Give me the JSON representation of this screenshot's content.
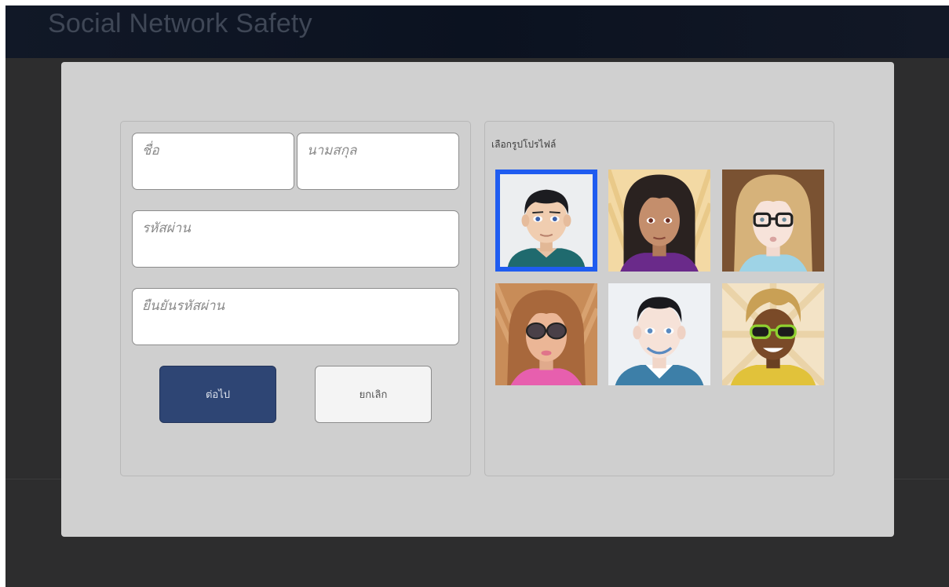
{
  "header": {
    "app_title": "Social Network Safety"
  },
  "form": {
    "first_name": {
      "placeholder": "ชื่อ",
      "value": ""
    },
    "last_name": {
      "placeholder": "นามสกุล",
      "value": ""
    },
    "password": {
      "placeholder": "รหัสผ่าน",
      "value": ""
    },
    "confirm_password": {
      "placeholder": "ยืนยันรหัสผ่าน",
      "value": ""
    },
    "next_label": "ต่อไป",
    "cancel_label": "ยกเลิก"
  },
  "profile_picker": {
    "label": "เลือกรูปโปรไฟล์",
    "selected_index": 0,
    "selection_color": "#1f5cf0",
    "avatars": [
      {
        "name": "boy-short-black-hair-avatar"
      },
      {
        "name": "girl-long-curly-hair-avatar"
      },
      {
        "name": "girl-blonde-glasses-avatar"
      },
      {
        "name": "girl-sunglasses-avatar"
      },
      {
        "name": "boy-smiling-avatar"
      },
      {
        "name": "boy-green-sunglasses-avatar"
      }
    ]
  },
  "colors": {
    "next_button": "#2e4574",
    "cancel_button": "#f4f4f4",
    "modal_background": "#d0d0d0",
    "header_background": "#0b1220"
  }
}
